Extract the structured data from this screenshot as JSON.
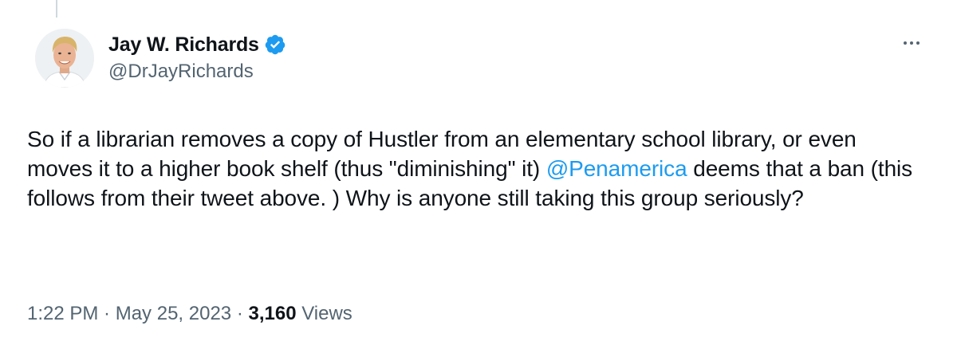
{
  "author": {
    "display_name": "Jay W. Richards",
    "handle": "@DrJayRichards",
    "verified": true
  },
  "tweet": {
    "text_before_mention": "So if a librarian removes a copy of Hustler from an elementary school library, or even moves it to a higher book shelf (thus \"diminishing\" it) ",
    "mention": "@Penamerica",
    "text_after_mention": " deems that a ban (this follows from their tweet above. ) Why is anyone still taking this group seriously?"
  },
  "meta": {
    "time": "1:22 PM",
    "separator_1": " · ",
    "date": "May 25, 2023",
    "separator_2": " · ",
    "views_count": "3,160",
    "views_label": " Views"
  },
  "colors": {
    "accent": "#1d9bf0",
    "text": "#0f1419",
    "secondary": "#536471"
  },
  "icons": {
    "verified": "verified-badge-icon",
    "more": "more-options-icon"
  }
}
